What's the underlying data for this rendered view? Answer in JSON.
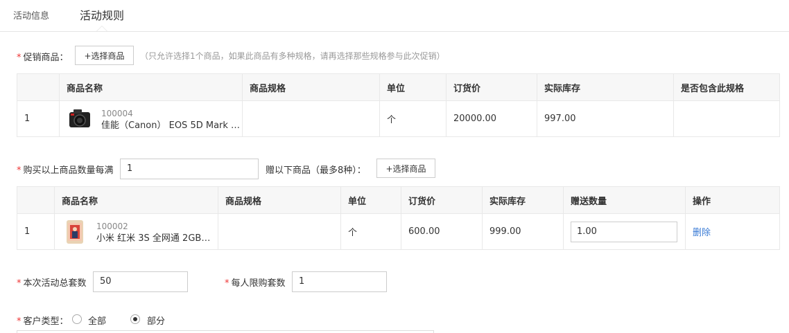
{
  "tabs": [
    {
      "label": "活动信息"
    },
    {
      "label": "活动规则"
    }
  ],
  "promo_products": {
    "label": "促销商品：",
    "select_button": "+选择商品",
    "hint": "（只允许选择1个商品，如果此商品有多种规格，请再选择那些规格参与此次促销）",
    "columns": [
      "",
      "商品名称",
      "商品规格",
      "单位",
      "订货价",
      "实际库存",
      "是否包含此规格"
    ],
    "rows": [
      {
        "index": "1",
        "code": "100004",
        "name": "佳能（Canon） EOS 5D Mark …",
        "spec": "",
        "unit": "个",
        "price": "20000.00",
        "stock": "997.00",
        "include": ""
      }
    ]
  },
  "gift": {
    "label": "购买以上商品数量每满",
    "threshold_value": "1",
    "gift_label": "赠以下商品（最多8种）：",
    "select_button": "+选择商品",
    "columns": [
      "",
      "商品名称",
      "商品规格",
      "单位",
      "订货价",
      "实际库存",
      "赠送数量",
      "操作"
    ],
    "rows": [
      {
        "index": "1",
        "code": "100002",
        "name": "小米 红米 3S 全网通 2GB…",
        "spec": "",
        "unit": "个",
        "price": "600.00",
        "stock": "999.00",
        "quantity": "1.00",
        "action": "删除"
      }
    ]
  },
  "limits": {
    "total_label": "本次活动总套数",
    "total_value": "50",
    "per_person_label": "每人限购套数",
    "per_person_value": "1"
  },
  "customer_type": {
    "label": "客户类型：",
    "options": [
      "全部",
      "部分"
    ],
    "selected": "部分"
  }
}
